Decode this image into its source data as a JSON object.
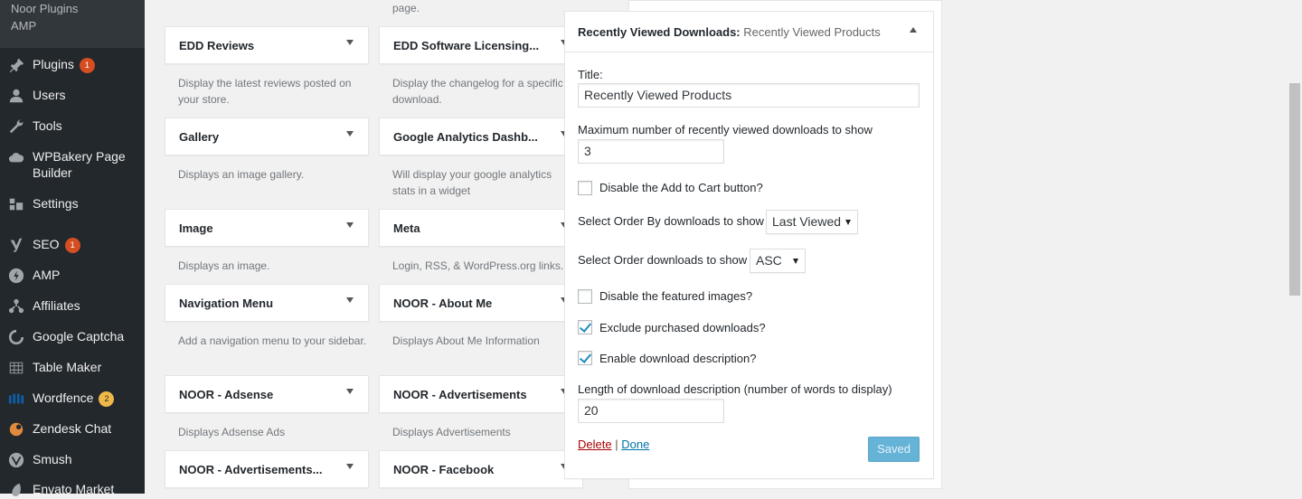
{
  "sidebar": {
    "submenu": [
      "Noor Plugins",
      "AMP"
    ],
    "items": [
      {
        "label": "Plugins",
        "icon": "plug-icon",
        "badge": "1",
        "badge_color": "#d54e21"
      },
      {
        "label": "Users",
        "icon": "users-icon"
      },
      {
        "label": "Tools",
        "icon": "wrench-icon"
      },
      {
        "label": "WPBakery Page Builder",
        "icon": "cloud-icon"
      },
      {
        "label": "Settings",
        "icon": "settings-icon"
      },
      {
        "label": "SEO",
        "icon": "yoast-icon",
        "badge": "1",
        "badge_color": "#d54e21"
      },
      {
        "label": "AMP",
        "icon": "amp-icon"
      },
      {
        "label": "Affiliates",
        "icon": "affiliates-icon"
      },
      {
        "label": "Google Captcha",
        "icon": "captcha-icon"
      },
      {
        "label": "Table Maker",
        "icon": "table-icon"
      },
      {
        "label": "Wordfence",
        "icon": "wordfence-icon",
        "badge": "2",
        "badge_color": "#f0b849"
      },
      {
        "label": "Zendesk Chat",
        "icon": "zendesk-icon"
      },
      {
        "label": "Smush",
        "icon": "smush-icon"
      },
      {
        "label": "Envato Market",
        "icon": "envato-icon"
      }
    ]
  },
  "widgets": {
    "top_right_desc": "page.",
    "col1": [
      {
        "title": "EDD Reviews",
        "desc": "Display the latest reviews posted on your store."
      },
      {
        "title": "Gallery",
        "desc": "Displays an image gallery."
      },
      {
        "title": "Image",
        "desc": "Displays an image."
      },
      {
        "title": "Navigation Menu",
        "desc": "Add a navigation menu to your sidebar."
      },
      {
        "title": "NOOR - Adsense",
        "desc": "Displays Adsense Ads"
      },
      {
        "title": "NOOR - Advertisements...",
        "desc": ""
      }
    ],
    "col2": [
      {
        "title": "EDD Software Licensing...",
        "desc": "Display the changelog for a specific download."
      },
      {
        "title": "Google Analytics Dashb...",
        "desc": "Will display your google analytics stats in a widget"
      },
      {
        "title": "Meta",
        "desc": "Login, RSS, & WordPress.org links."
      },
      {
        "title": "NOOR - About Me",
        "desc": "Displays About Me Information"
      },
      {
        "title": "NOOR - Advertisements",
        "desc": "Displays Advertisements"
      },
      {
        "title": "NOOR - Facebook",
        "desc": ""
      }
    ]
  },
  "editor": {
    "widget_name": "Recently Viewed Downloads:",
    "widget_subtitle": "Recently Viewed Products",
    "title_label": "Title:",
    "title_value": "Recently Viewed Products",
    "max_label": "Maximum number of recently viewed downloads to show",
    "max_value": "3",
    "disable_cart_label": "Disable the Add to Cart button?",
    "disable_cart_checked": false,
    "order_by_label": "Select Order By downloads to show",
    "order_by_value": "Last Viewed",
    "order_label": "Select Order downloads to show",
    "order_value": "ASC",
    "disable_images_label": "Disable the featured images?",
    "disable_images_checked": false,
    "exclude_label": "Exclude purchased downloads?",
    "exclude_checked": true,
    "enable_desc_label": "Enable download description?",
    "enable_desc_checked": true,
    "length_label": "Length of download description (number of words to display)",
    "length_value": "20",
    "delete_label": "Delete",
    "separator": "|",
    "done_label": "Done",
    "save_label": "Saved"
  }
}
